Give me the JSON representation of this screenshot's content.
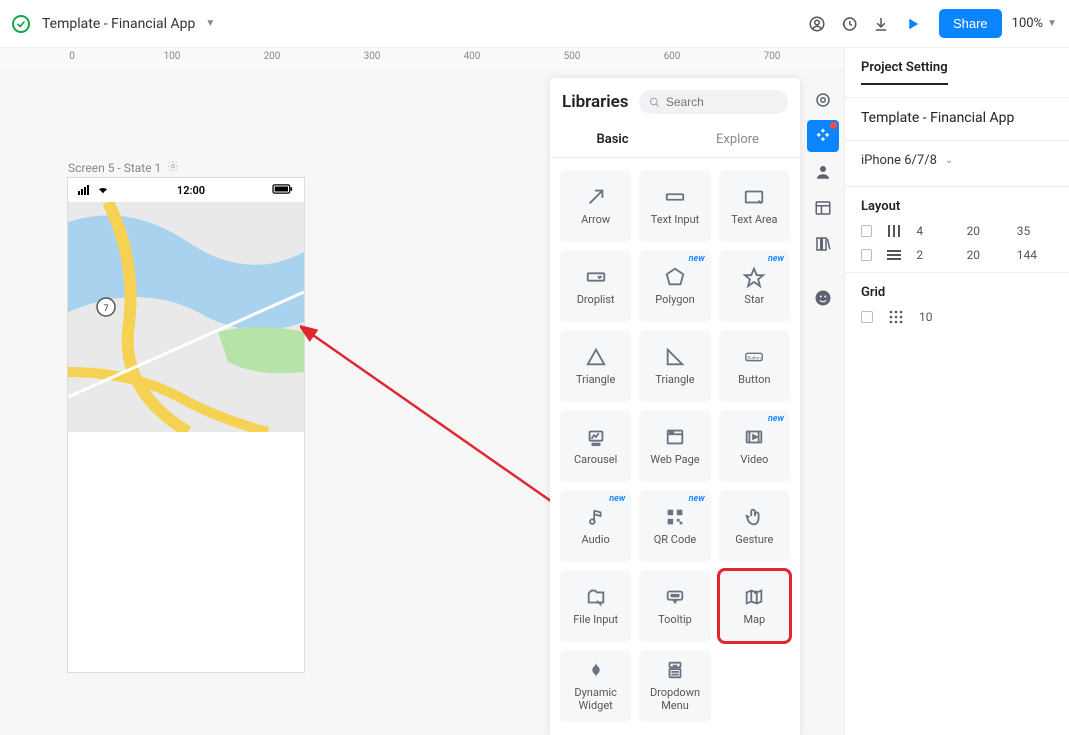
{
  "topbar": {
    "doc_title": "Template - Financial App",
    "share_label": "Share",
    "zoom": "100%"
  },
  "ruler": {
    "ticks": [
      "0",
      "100",
      "200",
      "300",
      "400",
      "500",
      "600",
      "700"
    ]
  },
  "canvas": {
    "screen_label": "Screen 5 - State 1",
    "phone_time": "12:00",
    "map_route_badge": "7"
  },
  "libraries": {
    "title": "Libraries",
    "search_placeholder": "Search",
    "tabs": {
      "basic": "Basic",
      "explore": "Explore"
    },
    "items": [
      {
        "label": "Arrow"
      },
      {
        "label": "Text Input"
      },
      {
        "label": "Text Area"
      },
      {
        "label": "Droplist"
      },
      {
        "label": "Polygon",
        "new": "new"
      },
      {
        "label": "Star",
        "new": "new"
      },
      {
        "label": "Triangle"
      },
      {
        "label": "Triangle"
      },
      {
        "label": "Button"
      },
      {
        "label": "Carousel"
      },
      {
        "label": "Web Page"
      },
      {
        "label": "Video",
        "new": "new"
      },
      {
        "label": "Audio",
        "new": "new"
      },
      {
        "label": "QR Code",
        "new": "new"
      },
      {
        "label": "Gesture"
      },
      {
        "label": "File Input"
      },
      {
        "label": "Tooltip"
      },
      {
        "label": "Map"
      },
      {
        "label": "Dynamic Widget"
      },
      {
        "label": "Dropdown Menu"
      }
    ],
    "highlighted_index": 17
  },
  "right_panel": {
    "tab": "Project Setting",
    "title": "Template - Financial App",
    "device": "iPhone 6/7/8",
    "layout_head": "Layout",
    "layout_rows": [
      {
        "a": "4",
        "b": "20",
        "c": "35"
      },
      {
        "a": "2",
        "b": "20",
        "c": "144"
      }
    ],
    "grid_head": "Grid",
    "grid_value": "10"
  }
}
